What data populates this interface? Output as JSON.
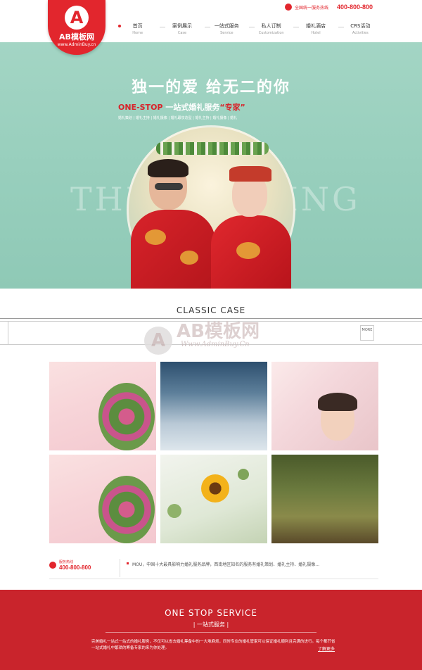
{
  "header": {
    "logo": {
      "glyph": "A",
      "name": "AB模板网",
      "url": "www.AdminBuy.cn"
    },
    "hotline": {
      "label": "全国统一服务热线",
      "number": "400-800-800"
    },
    "nav": [
      {
        "zh": "首页",
        "en": "Home",
        "active": true
      },
      {
        "zh": "案例展示",
        "en": "Case"
      },
      {
        "zh": "一站式服务",
        "en": "Service"
      },
      {
        "zh": "私人订制",
        "en": "Customization"
      },
      {
        "zh": "婚礼酒店",
        "en": "Hotel"
      },
      {
        "zh": "CRS活动",
        "en": "Activities"
      }
    ]
  },
  "banner": {
    "title": "独一的爱 给无二的你",
    "sub_prefix": "ONE-STOP",
    "sub_main": "一站式婚礼服务",
    "sub_highlight": "“专家”",
    "tags": "婚礼策划 | 婚礼主持 | 婚礼摄像 | 婚礼跟妆造型 | 婚礼主持 | 婚礼摄像 | 婚礼",
    "bg_text": "THE WEDDING"
  },
  "classic": {
    "title": "CLASSIC CASE",
    "more": "MORE"
  },
  "watermark": {
    "glyph": "A",
    "name": "AB模板网",
    "url": "Www.AdminBuy.Cn"
  },
  "info": {
    "label": "服务热线",
    "number": "400-800-800",
    "text": "MOU，中国十大最具影响力婚礼服务品牌，西南地区知名的服务有婚礼策划、婚礼主持、婚礼摄像..."
  },
  "footer": {
    "title": "ONE STOP SERVICE",
    "subtitle": "| 一站式服务 |",
    "text": "完美婚礼一站式一站式的婚礼服务，不仅可以省去婚礼筹备中的一大堆麻烦，同时专业的婚礼管家可以保证婚礼顺利且完满的进行。每个都节省一站式婚礼中繁琐的筹备专家的来为你处理。",
    "more": "了解更多"
  },
  "colors": {
    "brand": "#e2262d",
    "banner_bg": "#98cfbd",
    "footer_bg": "#c9242c"
  }
}
